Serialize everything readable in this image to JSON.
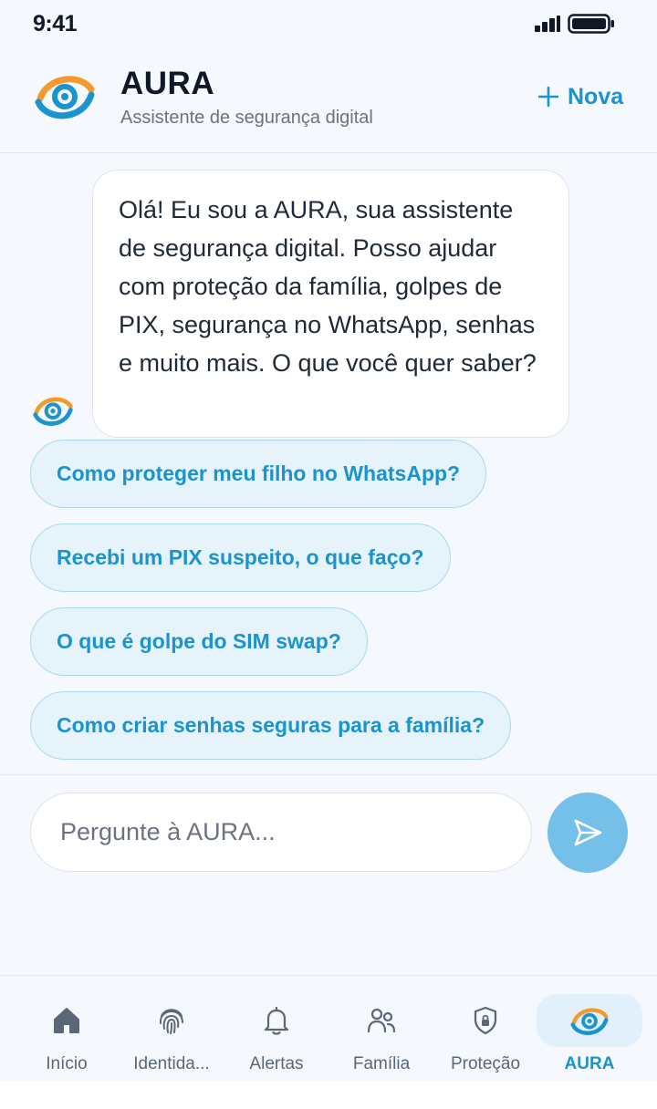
{
  "status_bar": {
    "time": "9:41",
    "icons": [
      "signal-icon",
      "battery-icon"
    ]
  },
  "header": {
    "title": "AURA",
    "subtitle": "Assistente de segurança digital",
    "new_button": "Nova",
    "logo_icon": "aura-eye-logo",
    "plus_icon": "plus-icon"
  },
  "chat": {
    "assistant_message": "Olá! Eu sou a AURA, sua assistente de segurança digital. Posso ajudar com proteção da família, golpes de PIX, segurança no WhatsApp, senhas e muito mais. O que você quer saber?",
    "suggestions": [
      "Como proteger meu filho no WhatsApp?",
      "Recebi um PIX suspeito, o que faço?",
      "O que é golpe do SIM swap?",
      "Como criar senhas seguras para a família?"
    ]
  },
  "composer": {
    "value": "",
    "placeholder": "Pergunte à AURA...",
    "send_icon": "send-icon"
  },
  "tabs": [
    {
      "label": "Início",
      "icon": "home-icon",
      "active": false
    },
    {
      "label": "Identida...",
      "icon": "fingerprint-icon",
      "active": false
    },
    {
      "label": "Alertas",
      "icon": "bell-icon",
      "active": false
    },
    {
      "label": "Família",
      "icon": "family-icon",
      "active": false
    },
    {
      "label": "Proteção",
      "icon": "shield-lock-icon",
      "active": false
    },
    {
      "label": "AURA",
      "icon": "aura-eye-icon",
      "active": true
    }
  ],
  "colors": {
    "accent": "#1a93cf",
    "accent_orange": "#f39a2e",
    "chip_background": "#e6f3fb",
    "chip_border": "#a9d9f1",
    "send_button": "#74c0e8",
    "background": "#f5f8fc",
    "text_dark": "#111827",
    "text_muted": "#6b7280"
  }
}
